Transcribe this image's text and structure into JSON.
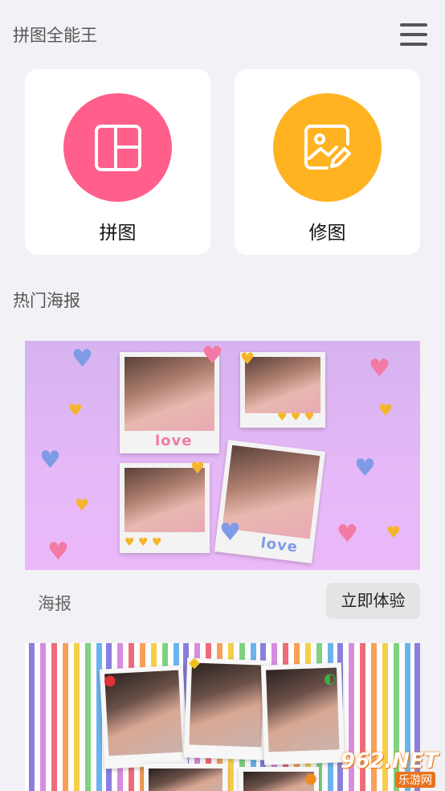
{
  "header": {
    "title": "拼图全能王",
    "menu_icon": "hamburger-menu-icon"
  },
  "actions": [
    {
      "label": "拼图",
      "icon": "collage-layout-icon",
      "color": "#ff5f8a"
    },
    {
      "label": "修图",
      "icon": "photo-edit-icon",
      "color": "#ffb321"
    }
  ],
  "section": {
    "title": "热门海报"
  },
  "poster": {
    "love_text_1": "love",
    "love_text_2": "love",
    "footer_label": "海报",
    "button_label": "立即体验"
  },
  "watermark": {
    "main": "962.NET",
    "sub": "乐游网"
  }
}
